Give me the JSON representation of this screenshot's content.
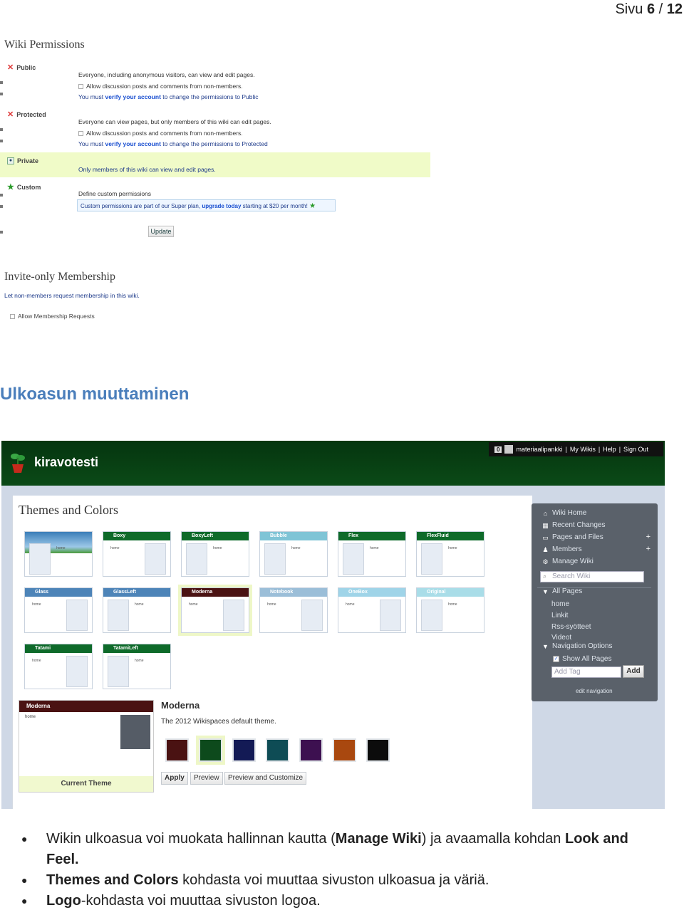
{
  "page_number": {
    "prefix": "Sivu",
    "current": "6",
    "separator": "/",
    "total": "12"
  },
  "permissions": {
    "title": "Wiki Permissions",
    "public": {
      "label": "Public",
      "desc": "Everyone, including anonymous visitors, can view and edit pages.",
      "allow": "Allow discussion posts and comments from non-members.",
      "verify_pre": "You must",
      "verify_link": "verify your account",
      "verify_post": "to change the permissions to Public"
    },
    "protected": {
      "label": "Protected",
      "desc": "Everyone can view pages, but only members of this wiki can edit pages.",
      "allow": "Allow discussion posts and comments from non-members.",
      "verify_pre": "You must",
      "verify_link": "verify your account",
      "verify_post": "to change the permissions to Protected"
    },
    "private": {
      "label": "Private",
      "desc": "Only members of this wiki can view and edit pages."
    },
    "custom": {
      "label": "Custom",
      "desc": "Define custom permissions",
      "promo_pre": "Custom permissions are part of our Super plan,",
      "promo_link": "upgrade today",
      "promo_post": "starting at $20 per month!"
    },
    "update_button": "Update"
  },
  "invite": {
    "title": "Invite-only Membership",
    "desc": "Let non-members request membership in this wiki.",
    "checkbox_label": "Allow Membership Requests"
  },
  "section_title": "Ulkoasun muuttaminen",
  "themes_shot": {
    "site_title": "kiravotesti",
    "userbar": {
      "badge": "0",
      "user": "materiaalipankki",
      "links": [
        "My Wikis",
        "Help",
        "Sign Out"
      ]
    },
    "heading": "Themes and Colors",
    "themes": [
      {
        "name": "",
        "head_color": "#3a7db8"
      },
      {
        "name": "Boxy",
        "head_color": "#0e6a2a"
      },
      {
        "name": "BoxyLeft",
        "head_color": "#0e6a2a"
      },
      {
        "name": "Bubble",
        "head_color": "#7fc4d6"
      },
      {
        "name": "Flex",
        "head_color": "#0e6a2a"
      },
      {
        "name": "FlexFluid",
        "head_color": "#0e6a2a"
      },
      {
        "name": "Glass",
        "head_color": "#4d84b8"
      },
      {
        "name": "GlassLeft",
        "head_color": "#4d84b8"
      },
      {
        "name": "Moderna",
        "head_color": "#4a1212"
      },
      {
        "name": "Notebook",
        "head_color": "#9bbed8"
      },
      {
        "name": "OneBox",
        "head_color": "#9fd4e8"
      },
      {
        "name": "Original",
        "head_color": "#a9dde8"
      },
      {
        "name": "Tatami",
        "head_color": "#0e6a2a"
      },
      {
        "name": "TatamiLeft",
        "head_color": "#0e6a2a"
      }
    ],
    "thumb_home": "home",
    "preview_name": "Moderna",
    "preview_home": "home",
    "current_theme_label": "Current Theme",
    "selected_name": "Moderna",
    "selected_desc": "The 2012 Wikispaces default theme.",
    "swatches": [
      "#4a1212",
      "#0d4a1c",
      "#131a55",
      "#0e4c55",
      "#3d1050",
      "#a9480f",
      "#0c0c0c"
    ],
    "buttons": {
      "apply": "Apply",
      "preview": "Preview",
      "customize": "Preview and Customize"
    },
    "nav": {
      "wiki_home": "Wiki Home",
      "recent_changes": "Recent Changes",
      "pages_files": "Pages and Files",
      "members": "Members",
      "manage_wiki": "Manage Wiki",
      "search_placeholder": "Search Wiki",
      "all_pages": "All Pages",
      "pages": [
        "home",
        "Linkit",
        "Rss-syötteet",
        "Videot"
      ],
      "nav_options": "Navigation Options",
      "show_all": "Show All Pages",
      "tag_placeholder": "Add Tag",
      "add_button": "Add",
      "edit_navigation": "edit navigation"
    }
  },
  "bullets": {
    "b1_pre": "Wikin ulkoasua voi muokata hallinnan kautta (",
    "b1_bold1": "Manage Wiki",
    "b1_mid": ") ja avaamalla kohdan ",
    "b1_bold2": "Look and Feel.",
    "b2_bold": "Themes and Colors",
    "b2_post": " kohdasta voi muuttaa sivuston ulkoasua ja väriä.",
    "b3_bold": "Logo",
    "b3_post": "-kohdasta voi muuttaa sivuston logoa."
  }
}
